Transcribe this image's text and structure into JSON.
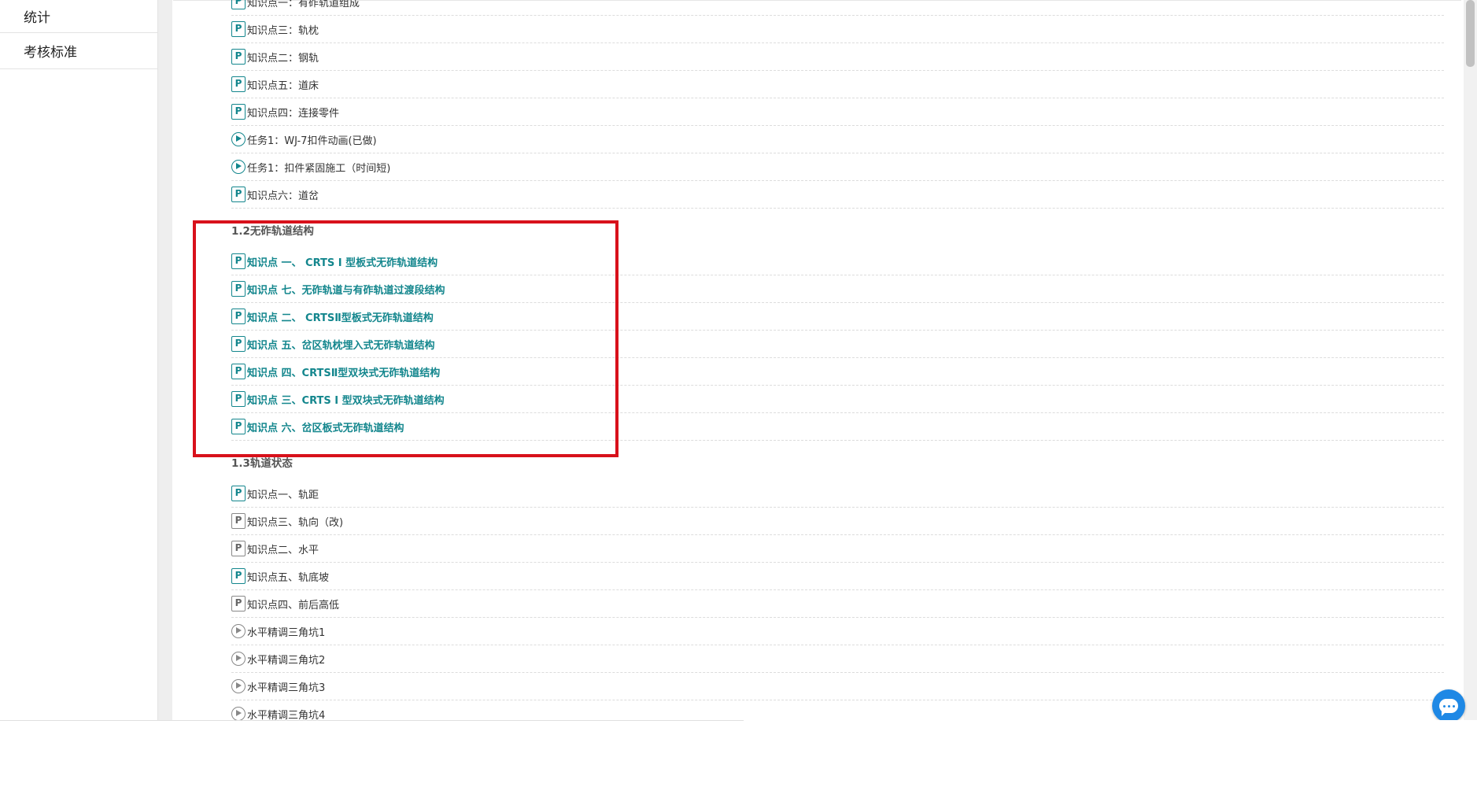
{
  "sidebar": {
    "items": [
      {
        "label": "统计"
      },
      {
        "label": "考核标准"
      }
    ]
  },
  "rows": [
    {
      "text": "知识点一：有砟轨道组成",
      "icon": "p",
      "hl": false,
      "gray": false
    },
    {
      "text": "知识点三：轨枕",
      "icon": "p",
      "hl": false,
      "gray": false
    },
    {
      "text": "知识点二：钢轨",
      "icon": "p",
      "hl": false,
      "gray": false
    },
    {
      "text": "知识点五：道床",
      "icon": "p",
      "hl": false,
      "gray": false
    },
    {
      "text": "知识点四：连接零件",
      "icon": "p",
      "hl": false,
      "gray": false
    },
    {
      "text": "任务1：WJ-7扣件动画(已做)",
      "icon": "play",
      "hl": false,
      "gray": false
    },
    {
      "text": "任务1：扣件紧固施工（时间短)",
      "icon": "play",
      "hl": false,
      "gray": false
    },
    {
      "text": "知识点六：道岔",
      "icon": "p",
      "hl": false,
      "gray": false
    }
  ],
  "sections": [
    {
      "title": "1.2无砟轨道结构",
      "rows": [
        {
          "text": "知识点 一、 CRTS Ⅰ 型板式无砟轨道结构",
          "icon": "p",
          "hl": true,
          "gray": false
        },
        {
          "text": "知识点 七、无砟轨道与有砟轨道过渡段结构",
          "icon": "p",
          "hl": true,
          "gray": false
        },
        {
          "text": "知识点 二、 CRTSⅡ型板式无砟轨道结构",
          "icon": "p",
          "hl": true,
          "gray": false
        },
        {
          "text": "知识点 五、岔区轨枕埋入式无砟轨道结构",
          "icon": "p",
          "hl": true,
          "gray": false
        },
        {
          "text": "知识点 四、CRTSⅡ型双块式无砟轨道结构",
          "icon": "p",
          "hl": true,
          "gray": false
        },
        {
          "text": "知识点 三、CRTS Ⅰ 型双块式无砟轨道结构",
          "icon": "p",
          "hl": true,
          "gray": false
        },
        {
          "text": "知识点 六、岔区板式无砟轨道结构",
          "icon": "p",
          "hl": true,
          "gray": false
        }
      ]
    },
    {
      "title": "1.3轨道状态",
      "rows": [
        {
          "text": "知识点一、轨距",
          "icon": "p",
          "hl": false,
          "gray": false
        },
        {
          "text": "知识点三、轨向（改)",
          "icon": "p",
          "hl": false,
          "gray": true
        },
        {
          "text": "知识点二、水平",
          "icon": "p",
          "hl": false,
          "gray": true
        },
        {
          "text": "知识点五、轨底坡",
          "icon": "p",
          "hl": false,
          "gray": false
        },
        {
          "text": "知识点四、前后高低",
          "icon": "p",
          "hl": false,
          "gray": true
        },
        {
          "text": "水平精调三角坑1",
          "icon": "play",
          "hl": false,
          "gray": true
        },
        {
          "text": "水平精调三角坑2",
          "icon": "play",
          "hl": false,
          "gray": true
        },
        {
          "text": "水平精调三角坑3",
          "icon": "play",
          "hl": false,
          "gray": true
        },
        {
          "text": "水平精调三角坑4",
          "icon": "play",
          "hl": false,
          "gray": true
        }
      ]
    }
  ]
}
